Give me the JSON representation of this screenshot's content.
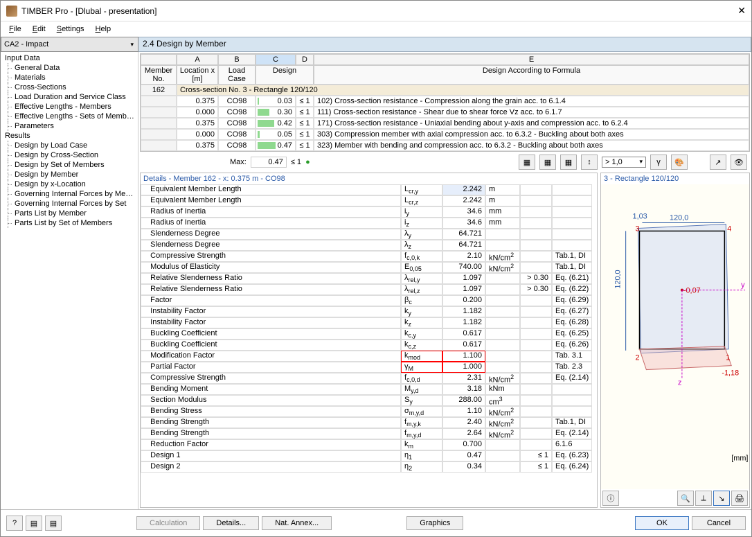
{
  "title": "TIMBER Pro - [Dlubal - presentation]",
  "menu": [
    "File",
    "Edit",
    "Settings",
    "Help"
  ],
  "combo": "CA2 - Impact",
  "section_heading": "2.4  Design by Member",
  "tree": {
    "groups": [
      {
        "label": "Input Data",
        "items": [
          "General Data",
          "Materials",
          "Cross-Sections",
          "Load Duration and Service Class",
          "Effective Lengths - Members",
          "Effective Lengths - Sets of Members",
          "Parameters"
        ]
      },
      {
        "label": "Results",
        "items": [
          "Design by Load Case",
          "Design by Cross-Section",
          "Design by Set of Members",
          "Design by Member",
          "Design by x-Location",
          "Governing Internal Forces by Member",
          "Governing Internal Forces by Set",
          "Parts List by Member",
          "Parts List by Set of Members"
        ]
      }
    ]
  },
  "grid": {
    "cols": [
      "A",
      "B",
      "C",
      "D",
      "E"
    ],
    "memberhdr": "Member No.",
    "sub": [
      "Location x [m]",
      "Load Case",
      "Design",
      "",
      "Design According to Formula"
    ],
    "section_row": "Cross-section No.  3 - Rectangle 120/120",
    "member_no": "162",
    "rows": [
      {
        "x": "0.375",
        "lc": "CO98",
        "d": "0.03",
        "chk": "≤ 1",
        "desc": "102) Cross-section resistance - Compression along the grain acc. to 6.1.4",
        "bar": 3
      },
      {
        "x": "0.000",
        "lc": "CO98",
        "d": "0.30",
        "chk": "≤ 1",
        "desc": "111) Cross-section resistance - Shear due to shear force Vz acc. to 6.1.7",
        "bar": 30
      },
      {
        "x": "0.375",
        "lc": "CO98",
        "d": "0.42",
        "chk": "≤ 1",
        "desc": "171) Cross-section resistance - Uniaxial bending about y-axis and compression acc. to 6.2.4",
        "bar": 42
      },
      {
        "x": "0.000",
        "lc": "CO98",
        "d": "0.05",
        "chk": "≤ 1",
        "desc": "303) Compression member with axial compression acc. to 6.3.2 - Buckling about both axes",
        "bar": 5
      },
      {
        "x": "0.375",
        "lc": "CO98",
        "d": "0.47",
        "chk": "≤ 1",
        "desc": "323) Member with bending and compression acc. to 6.3.2 - Buckling about both axes",
        "bar": 47,
        "sel": true
      }
    ],
    "max_label": "Max:",
    "max_val": "0.47",
    "max_chk": "≤ 1",
    "scale": "> 1,0"
  },
  "details": {
    "title": "Details - Member 162 - x: 0.375 m - CO98",
    "rows": [
      {
        "n": "Equivalent Member Length",
        "s": "L cr,y",
        "v": "2.242",
        "u": "m",
        "sel": true
      },
      {
        "n": "Equivalent Member Length",
        "s": "L cr,z",
        "v": "2.242",
        "u": "m"
      },
      {
        "n": "Radius of Inertia",
        "s": "i y",
        "v": "34.6",
        "u": "mm"
      },
      {
        "n": "Radius of Inertia",
        "s": "i z",
        "v": "34.6",
        "u": "mm"
      },
      {
        "n": "Slenderness Degree",
        "s": "λ y",
        "v": "64.721",
        "u": ""
      },
      {
        "n": "Slenderness Degree",
        "s": "λ z",
        "v": "64.721",
        "u": ""
      },
      {
        "n": "Compressive Strength",
        "s": "f c,0,k",
        "v": "2.10",
        "u": "kN/cm²",
        "r": "Tab.1, DI"
      },
      {
        "n": "Modulus of Elasticity",
        "s": "E 0,05",
        "v": "740.00",
        "u": "kN/cm²",
        "r": "Tab.1, DI"
      },
      {
        "n": "Relative Slenderness Ratio",
        "s": "λ rel,y",
        "v": "1.097",
        "u": "",
        "c": "> 0.30",
        "r": "Eq. (6.21)"
      },
      {
        "n": "Relative Slenderness Ratio",
        "s": "λ rel,z",
        "v": "1.097",
        "u": "",
        "c": "> 0.30",
        "r": "Eq. (6.22)"
      },
      {
        "n": "Factor",
        "s": "β c",
        "v": "0.200",
        "u": "",
        "r": "Eq. (6.29)"
      },
      {
        "n": "Instability Factor",
        "s": "k y",
        "v": "1.182",
        "u": "",
        "r": "Eq. (6.27)"
      },
      {
        "n": "Instability Factor",
        "s": "k z",
        "v": "1.182",
        "u": "",
        "r": "Eq. (6.28)"
      },
      {
        "n": "Buckling Coefficient",
        "s": "k c,y",
        "v": "0.617",
        "u": "",
        "r": "Eq. (6.25)"
      },
      {
        "n": "Buckling Coefficient",
        "s": "k c,z",
        "v": "0.617",
        "u": "",
        "r": "Eq. (6.26)"
      },
      {
        "n": "Modification Factor",
        "s": "k mod",
        "v": "1.100",
        "u": "",
        "r": "Tab. 3.1",
        "hl": true
      },
      {
        "n": "Partial Factor",
        "s": "γ M",
        "v": "1.000",
        "u": "",
        "r": "Tab. 2.3",
        "hl": true
      },
      {
        "n": "Compressive Strength",
        "s": "f c,0,d",
        "v": "2.31",
        "u": "kN/cm²",
        "r": "Eq. (2.14)"
      },
      {
        "n": "Bending Moment",
        "s": "M y,d",
        "v": "3.18",
        "u": "kNm"
      },
      {
        "n": "Section Modulus",
        "s": "S y",
        "v": "288.00",
        "u": "cm³"
      },
      {
        "n": "Bending Stress",
        "s": "σ m,y,d",
        "v": "1.10",
        "u": "kN/cm²"
      },
      {
        "n": "Bending Strength",
        "s": "f m,y,k",
        "v": "2.40",
        "u": "kN/cm²",
        "r": "Tab.1, DI"
      },
      {
        "n": "Bending Strength",
        "s": "f m,y,d",
        "v": "2.64",
        "u": "kN/cm²",
        "r": "Eq. (2.14)"
      },
      {
        "n": "Reduction Factor",
        "s": "k m",
        "v": "0.700",
        "u": "",
        "r": "6.1.6"
      },
      {
        "n": "Design 1",
        "s": "η 1",
        "v": "0.47",
        "u": "",
        "c": "≤ 1",
        "r": "Eq. (6.23)"
      },
      {
        "n": "Design 2",
        "s": "η 2",
        "v": "0.34",
        "u": "",
        "c": "≤ 1",
        "r": "Eq. (6.24)"
      }
    ]
  },
  "csview": {
    "title": "3 - Rectangle 120/120",
    "dim_w": "120,0",
    "dim_h": "120,0",
    "label_tl": "1,03",
    "label_c": "-0,07",
    "label_br": "-1,18",
    "unit": "[mm]",
    "axes": [
      "y",
      "z"
    ],
    "corners": [
      "1",
      "2",
      "3",
      "4"
    ]
  },
  "buttons": {
    "calc": "Calculation",
    "details": "Details...",
    "nat": "Nat. Annex...",
    "graphics": "Graphics",
    "ok": "OK",
    "cancel": "Cancel"
  }
}
